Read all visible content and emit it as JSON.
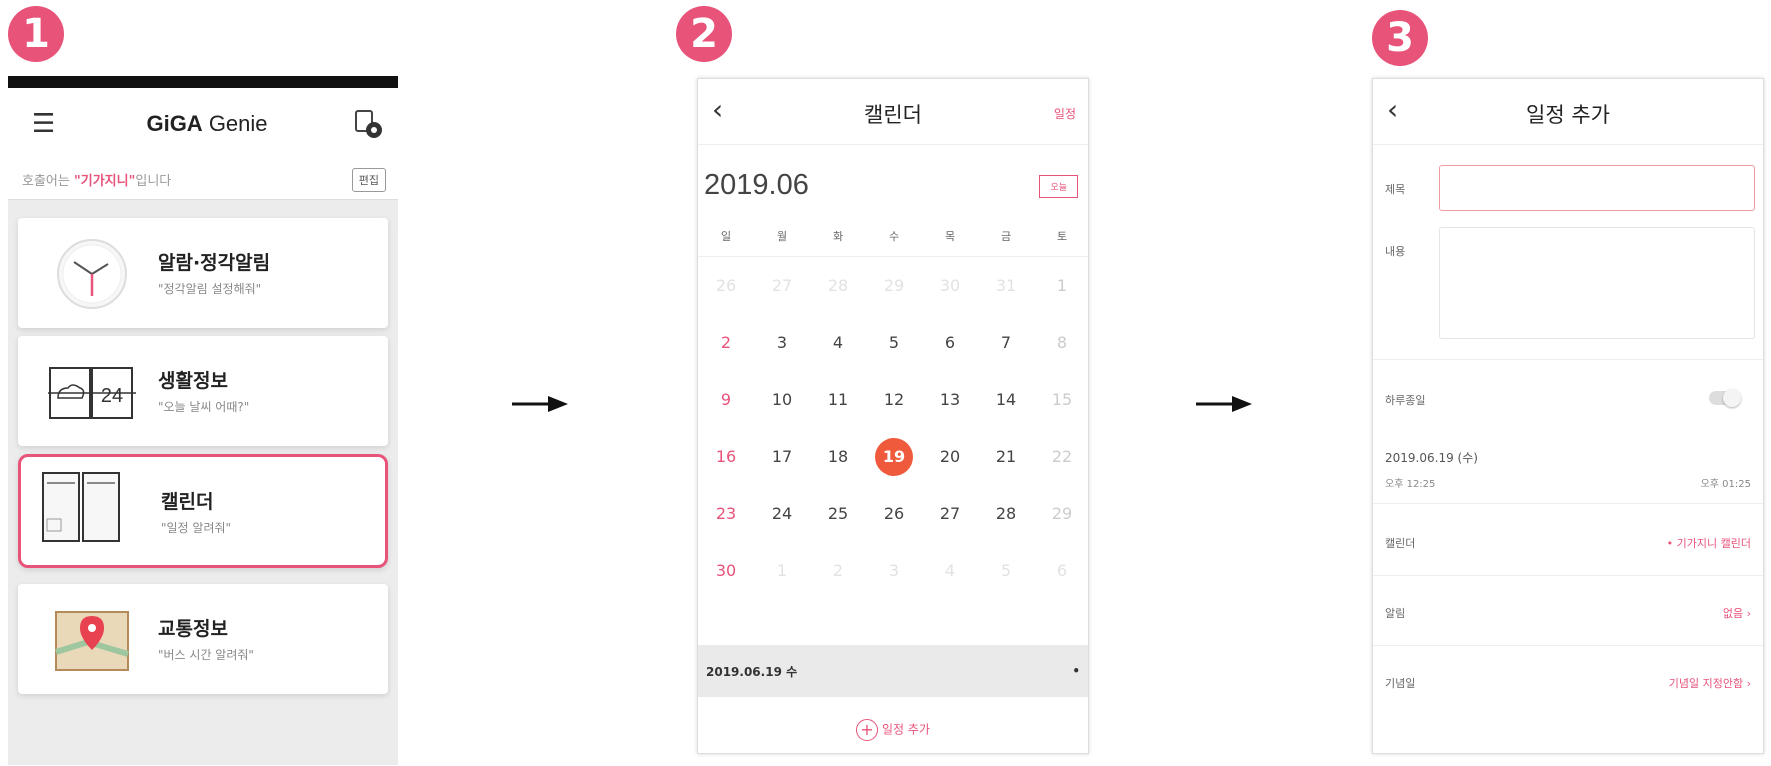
{
  "steps": [
    "1",
    "2",
    "3"
  ],
  "phone1": {
    "brand_bold": "GiGA",
    "brand_rest": " Genie",
    "greeting_pre": "호출어는 ",
    "greeting_name": "\"기가지니\"",
    "greeting_post": "입니다",
    "edit_label": "편집",
    "cards": [
      {
        "title": "알람·정각알림",
        "desc": "\"정각알림 설정해줘\""
      },
      {
        "title": "생활정보",
        "desc": "\"오늘 날씨 어때?\""
      },
      {
        "title": "캘린더",
        "desc": "\"일정 알려줘\""
      },
      {
        "title": "교통정보",
        "desc": "\"버스 시간 알려줘\""
      }
    ],
    "weather_num": "24"
  },
  "phone2": {
    "title": "캘린더",
    "right_label": "일정",
    "month": "2019.06",
    "today_label": "오늘",
    "weekdays": [
      "일",
      "월",
      "화",
      "수",
      "목",
      "금",
      "토"
    ],
    "weeks": [
      [
        "26",
        "27",
        "28",
        "29",
        "30",
        "31",
        "1"
      ],
      [
        "2",
        "3",
        "4",
        "5",
        "6",
        "7",
        "8"
      ],
      [
        "9",
        "10",
        "11",
        "12",
        "13",
        "14",
        "15"
      ],
      [
        "16",
        "17",
        "18",
        "19",
        "20",
        "21",
        "22"
      ],
      [
        "23",
        "24",
        "25",
        "26",
        "27",
        "28",
        "29"
      ],
      [
        "30",
        "1",
        "2",
        "3",
        "4",
        "5",
        "6"
      ]
    ],
    "selected_date": "19",
    "date_bar": "2019.06.19 수",
    "date_bar_dot": "•",
    "add_label": "일정 추가"
  },
  "phone3": {
    "title": "일정 추가",
    "subject_label": "제목",
    "content_label": "내용",
    "allday_label": "하루종일",
    "date": "2019.06.19 (수)",
    "start_time": "오후 12:25",
    "end_time": "오후 01:25",
    "calendar_label": "캘린더",
    "calendar_value": "• 기가지니 캘린더",
    "alarm_label": "알림",
    "alarm_value": "없음  ›",
    "anniversary_label": "기념일",
    "anniversary_value": "기념일 지정안함  ›"
  },
  "colors": {
    "accent": "#e8537a",
    "selected_day": "#f05a3c"
  }
}
